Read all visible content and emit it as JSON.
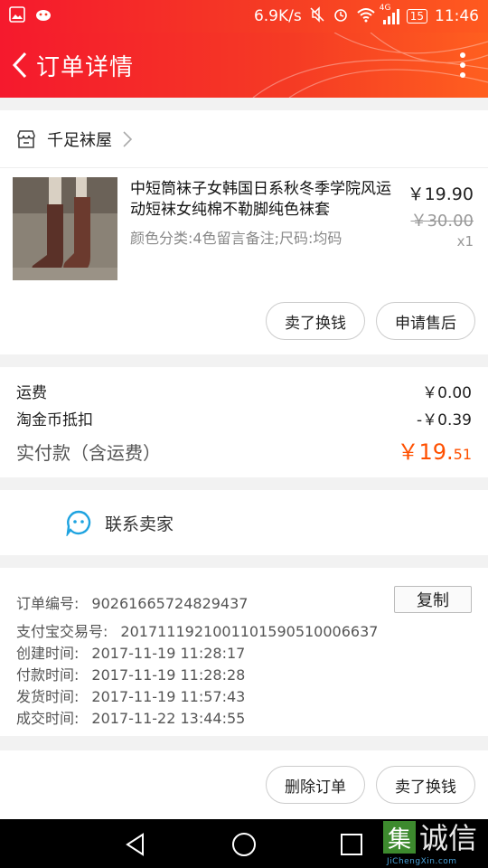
{
  "status": {
    "speed": "6.9K/s",
    "network": "4G",
    "battery": "15",
    "time": "11:46"
  },
  "header": {
    "title": "订单详情"
  },
  "shop": {
    "name": "千足袜屋"
  },
  "item": {
    "title": "中短筒袜子女韩国日系秋冬季学院风运动短袜女纯棉不勒脚纯色袜套",
    "sku": "颜色分类:4色留言备注;尺码:均码",
    "price": "￥19.90",
    "original_price": "￥30.00",
    "quantity": "x1",
    "btn_sell": "卖了换钱",
    "btn_aftersale": "申请售后"
  },
  "costs": {
    "shipping_label": "运费",
    "shipping_value": "￥0.00",
    "coin_label": "淘金币抵扣",
    "coin_value": "-￥0.39",
    "paid_label": "实付款（含运费）",
    "paid_currency": "￥",
    "paid_int": "19.",
    "paid_dec": "51"
  },
  "contact": {
    "label": "联系卖家"
  },
  "order": {
    "id_label": "订单编号:",
    "id_value": "90261665724829437",
    "alipay_label": "支付宝交易号:",
    "alipay_value": "2017111921001101590510006637",
    "created_label": "创建时间:",
    "created_value": "2017-11-19 11:28:17",
    "paid_label": "付款时间:",
    "paid_value": "2017-11-19 11:28:28",
    "shipped_label": "发货时间:",
    "shipped_value": "2017-11-19 11:57:43",
    "done_label": "成交时间:",
    "done_value": "2017-11-22 13:44:55",
    "copy_label": "复制"
  },
  "actions": {
    "delete": "删除订单",
    "sell": "卖了换钱"
  },
  "watermark": {
    "badge": "集",
    "text": "诚信",
    "url": "JiChengXin.com"
  },
  "colors": {
    "accent": "#f5192d",
    "price_orange": "#ff5000",
    "contact_blue": "#1ea3e0"
  }
}
